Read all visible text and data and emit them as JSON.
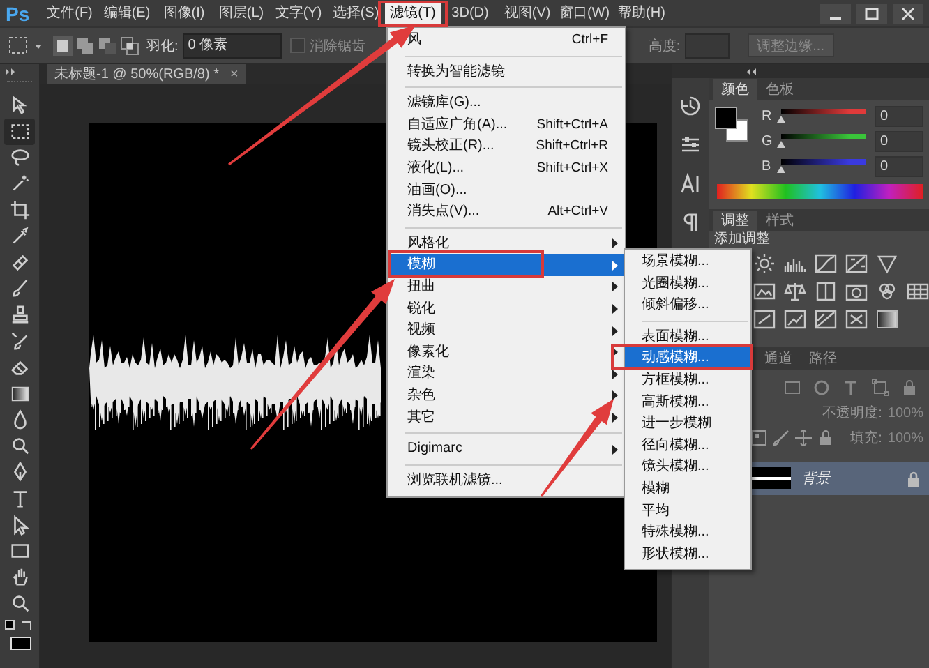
{
  "menubar": {
    "logo": "Ps",
    "items": [
      {
        "label": "文件(F)",
        "selected": false
      },
      {
        "label": "编辑(E)",
        "selected": false
      },
      {
        "label": "图像(I)",
        "selected": false
      },
      {
        "label": "图层(L)",
        "selected": false
      },
      {
        "label": "文字(Y)",
        "selected": false
      },
      {
        "label": "选择(S)",
        "selected": false
      },
      {
        "label": "滤镜(T)",
        "selected": true
      },
      {
        "label": "3D(D)",
        "selected": false
      },
      {
        "label": "视图(V)",
        "selected": false
      },
      {
        "label": "窗口(W)",
        "selected": false
      },
      {
        "label": "帮助(H)",
        "selected": false
      }
    ]
  },
  "options_bar": {
    "feather_label": "羽化:",
    "feather_value": "0 像素",
    "antialias": {
      "label": "消除锯齿",
      "checked": false,
      "disabled": true
    },
    "height_label": "高度:",
    "refine_edge_button": "调整边缘..."
  },
  "document_tab": {
    "title": "未标题-1 @ 50%(RGB/8) *",
    "close": "×"
  },
  "toolbar": {
    "tools": [
      {
        "selected": false
      },
      {
        "selected": true
      },
      {
        "selected": false
      },
      {
        "selected": false
      },
      {
        "selected": false
      },
      {
        "selected": false
      },
      {
        "selected": false
      },
      {
        "selected": false
      },
      {
        "selected": false
      },
      {
        "selected": false
      },
      {
        "selected": false
      },
      {
        "selected": false
      },
      {
        "selected": false
      },
      {
        "selected": false
      },
      {
        "selected": false
      },
      {
        "selected": false
      },
      {
        "selected": false
      },
      {
        "selected": false
      },
      {
        "selected": false
      },
      {
        "selected": false
      }
    ]
  },
  "color_panel": {
    "tabs": [
      {
        "label": "颜色",
        "selected": true
      },
      {
        "label": "色板",
        "selected": false
      }
    ],
    "channels": [
      {
        "name": "R",
        "color": "#e03a3a",
        "level": 0,
        "value": "0"
      },
      {
        "name": "G",
        "color": "#3ac43a",
        "level": 0,
        "value": "0"
      },
      {
        "name": "B",
        "color": "#3a3ae0",
        "level": 0,
        "value": "0"
      }
    ]
  },
  "adjustments_panel": {
    "tabs": [
      {
        "label": "调整",
        "selected": true
      },
      {
        "label": "样式",
        "selected": false
      }
    ],
    "heading": "添加调整"
  },
  "layers_panel": {
    "tabs": [
      {
        "label": "通道",
        "selected": false
      },
      {
        "label": "路径",
        "selected": false
      }
    ],
    "opacity_label": "不透明度:",
    "opacity_value": "100%",
    "fill_label": "填充:",
    "fill_value": "100%",
    "layers": [
      {
        "name": "背景",
        "selected": true
      }
    ]
  },
  "filter_menu": {
    "sections": [
      [
        {
          "label": "风",
          "shortcut": "Ctrl+F",
          "submenu": false,
          "selected": false
        }
      ],
      [
        {
          "label": "转换为智能滤镜",
          "submenu": false,
          "selected": false
        }
      ],
      [
        {
          "label": "滤镜库(G)...",
          "submenu": false,
          "selected": false
        },
        {
          "label": "自适应广角(A)...",
          "shortcut": "Shift+Ctrl+A",
          "submenu": false,
          "selected": false
        },
        {
          "label": "镜头校正(R)...",
          "shortcut": "Shift+Ctrl+R",
          "submenu": false,
          "selected": false
        },
        {
          "label": "液化(L)...",
          "shortcut": "Shift+Ctrl+X",
          "submenu": false,
          "selected": false
        },
        {
          "label": "油画(O)...",
          "submenu": false,
          "selected": false
        },
        {
          "label": "消失点(V)...",
          "shortcut": "Alt+Ctrl+V",
          "submenu": false,
          "selected": false
        }
      ],
      [
        {
          "label": "风格化",
          "submenu": true,
          "selected": false
        },
        {
          "label": "模糊",
          "submenu": true,
          "selected": true
        },
        {
          "label": "扭曲",
          "submenu": true,
          "selected": false
        },
        {
          "label": "锐化",
          "submenu": true,
          "selected": false
        },
        {
          "label": "视频",
          "submenu": true,
          "selected": false
        },
        {
          "label": "像素化",
          "submenu": true,
          "selected": false
        },
        {
          "label": "渲染",
          "submenu": true,
          "selected": false
        },
        {
          "label": "杂色",
          "submenu": true,
          "selected": false
        },
        {
          "label": "其它",
          "submenu": true,
          "selected": false
        }
      ],
      [
        {
          "label": "Digimarc",
          "submenu": true,
          "selected": false
        }
      ],
      [
        {
          "label": "浏览联机滤镜...",
          "submenu": false,
          "selected": false
        }
      ]
    ]
  },
  "blur_submenu": {
    "sections": [
      [
        {
          "label": "场景模糊...",
          "selected": false
        },
        {
          "label": "光圈模糊...",
          "selected": false
        },
        {
          "label": "倾斜偏移...",
          "selected": false
        }
      ],
      [
        {
          "label": "表面模糊...",
          "selected": false
        },
        {
          "label": "动感模糊...",
          "selected": true
        },
        {
          "label": "方框模糊...",
          "selected": false
        },
        {
          "label": "高斯模糊...",
          "selected": false
        },
        {
          "label": "进一步模糊",
          "selected": false
        },
        {
          "label": "径向模糊...",
          "selected": false
        },
        {
          "label": "镜头模糊...",
          "selected": false
        },
        {
          "label": "模糊",
          "selected": false
        },
        {
          "label": "平均",
          "selected": false
        },
        {
          "label": "特殊模糊...",
          "selected": false
        },
        {
          "label": "形状模糊...",
          "selected": false
        }
      ]
    ]
  }
}
